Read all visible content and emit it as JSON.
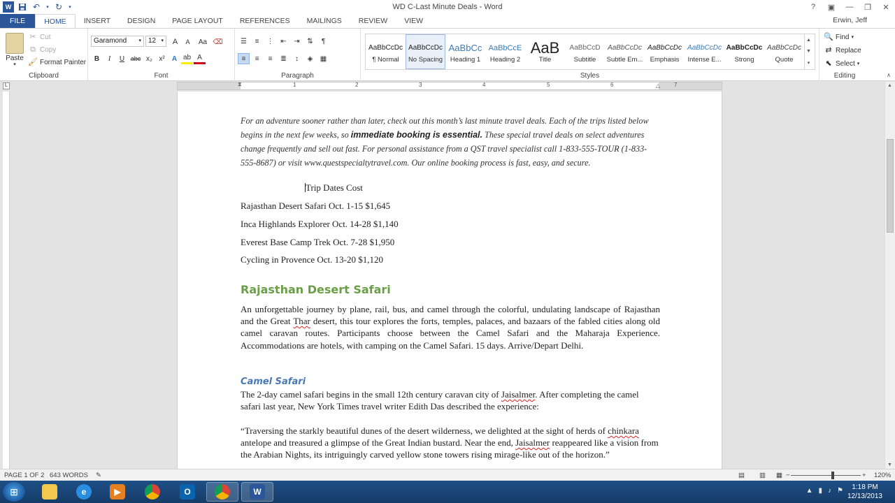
{
  "window": {
    "title": "WD C-Last Minute Deals - Word",
    "user": "Erwin, Jeff"
  },
  "tabs": [
    {
      "label": "FILE"
    },
    {
      "label": "HOME"
    },
    {
      "label": "INSERT"
    },
    {
      "label": "DESIGN"
    },
    {
      "label": "PAGE LAYOUT"
    },
    {
      "label": "REFERENCES"
    },
    {
      "label": "MAILINGS"
    },
    {
      "label": "REVIEW"
    },
    {
      "label": "VIEW"
    }
  ],
  "ribbon": {
    "clipboard": {
      "paste": "Paste",
      "cut": "Cut",
      "copy": "Copy",
      "format_painter": "Format Painter",
      "label": "Clipboard"
    },
    "font": {
      "font_name": "Garamond",
      "font_size": "12",
      "label": "Font",
      "grow": "A",
      "shrink": "A",
      "case": "Aa",
      "bold": "B",
      "italic": "I",
      "underline": "U",
      "strike": "abc",
      "subscript": "x₂",
      "superscript": "x²",
      "font_color_glyph": "A"
    },
    "paragraph": {
      "label": "Paragraph"
    },
    "styles": {
      "label": "Styles",
      "items": [
        {
          "sample": "AaBbCcDc",
          "name": "¶ Normal"
        },
        {
          "sample": "AaBbCcDc",
          "name": "No Spacing"
        },
        {
          "sample": "AaBbCc",
          "name": "Heading 1"
        },
        {
          "sample": "AaBbCcE",
          "name": "Heading 2"
        },
        {
          "sample": "AaB",
          "name": "Title"
        },
        {
          "sample": "AaBbCcD",
          "name": "Subtitle"
        },
        {
          "sample": "AaBbCcDc",
          "name": "Subtle Em..."
        },
        {
          "sample": "AaBbCcDc",
          "name": "Emphasis"
        },
        {
          "sample": "AaBbCcDc",
          "name": "Intense E..."
        },
        {
          "sample": "AaBbCcDc",
          "name": "Strong"
        },
        {
          "sample": "AaBbCcDc",
          "name": "Quote"
        }
      ]
    },
    "editing": {
      "find": "Find",
      "replace": "Replace",
      "select": "Select",
      "label": "Editing"
    }
  },
  "ruler": {
    "numbers": [
      "1",
      "2",
      "3",
      "4",
      "5",
      "6",
      "7"
    ]
  },
  "document": {
    "intro_before_bold": "For an adventure sooner rather than later, check out this month’s last minute travel deals. Each of the trips listed below begins in the next few weeks, so ",
    "intro_bold": "immediate booking is essential.",
    "intro_after_bold": " These special travel deals on select adventures change frequently and sell out fast. For personal assistance from a QST travel specialist call 1-833-555-TOUR (1-833-555-8687) or visit www.questspecialtytravel.com. Our online booking process is fast, easy, and secure.",
    "table_header": "Trip Dates Cost",
    "table_rows": [
      "Rajasthan Desert Safari Oct. 1-15 $1,645",
      "Inca Highlands Explorer Oct. 14-28 $1,140",
      "Everest Base Camp Trek Oct. 7-28 $1,950",
      "Cycling in Provence Oct. 13-20 $1,120"
    ],
    "heading1": "Rajasthan Desert Safari",
    "para1_a": "An unforgettable journey by plane, rail, bus, and camel through the colorful, undulating landscape of Rajasthan and the Great ",
    "para1_thar": "Thar",
    "para1_b": " desert, this tour explores the forts, temples, palaces, and bazaars of the fabled cities along old camel caravan routes. Participants choose between the Camel Safari and the Maharaja Experience. Accommodations are hotels, with camping on the Camel Safari. 15 days. Arrive/Depart Delhi.",
    "heading2": "Camel Safari",
    "para2_a": "The 2-day camel safari begins in the small 12th century caravan city of ",
    "para2_city": "Jaisalmer",
    "para2_b": ". After completing the camel safari last year, New York Times travel writer Edith Das described the experience:",
    "quote_a": "“Traversing the starkly beautiful dunes of the desert wilderness, we delighted at the sight of herds of ",
    "quote_chinkara": "chinkara",
    "quote_b": " antelope and treasured a glimpse of the Great Indian bustard. Near the end, ",
    "quote_city": "Jaisalmer",
    "quote_c": " reappeared like a vision from the Arabian Nights, its intriguingly carved yellow stone towers rising mirage-like out of the horizon.”"
  },
  "status": {
    "page": "PAGE 1 OF 2",
    "words": "643 WORDS",
    "zoom": "120%",
    "zoom_minus": "−",
    "zoom_plus": "+"
  },
  "taskbar": {
    "time": "1:18 PM",
    "date": "12/13/2013",
    "word_glyph": "W",
    "outlook_glyph": "O"
  },
  "colors": {
    "accent": "#2b579a",
    "heading1": "#6a9e47",
    "heading2": "#4a78b5"
  }
}
